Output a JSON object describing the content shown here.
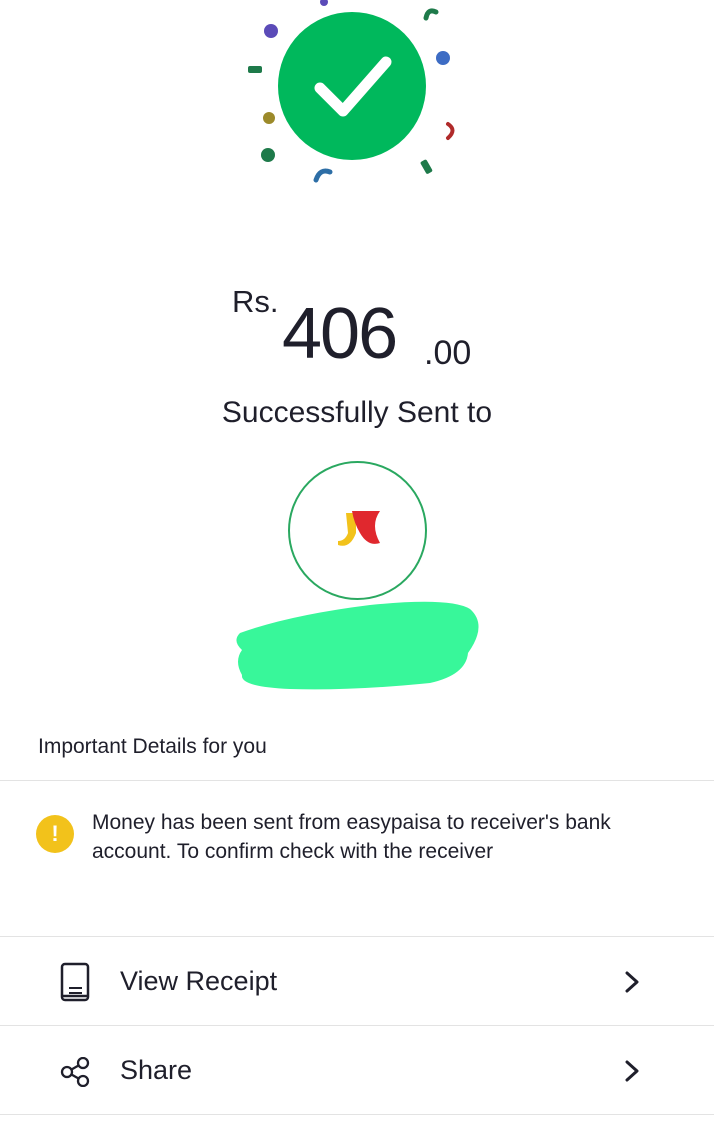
{
  "amount": {
    "currency": "Rs.",
    "integer": "406",
    "decimal": ".00"
  },
  "status_text": "Successfully Sent to",
  "colors": {
    "success_green": "#00b85c",
    "warning_yellow": "#f2c21b",
    "text_dark": "#1f1f2b"
  },
  "details": {
    "title": "Important Details for you",
    "message_line1": "Money has been sent from easypaisa to receiver's bank",
    "message_line2": "account. To confirm check with the receiver",
    "icon": "warning-icon"
  },
  "actions": [
    {
      "label": "View Receipt",
      "icon": "receipt-icon"
    },
    {
      "label": "Share",
      "icon": "share-icon"
    }
  ]
}
